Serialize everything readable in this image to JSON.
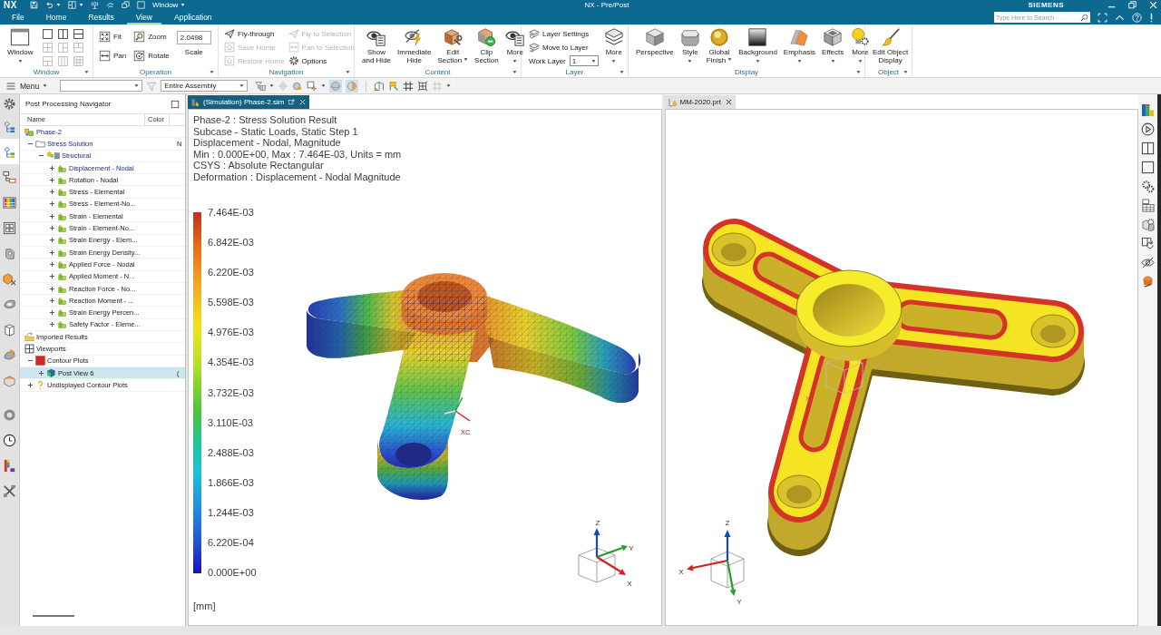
{
  "title_bar": {
    "logo": "NX",
    "window_menu": "Window",
    "title": "NX - Pre/Post",
    "brand": "SIEMENS"
  },
  "menu_tabs": [
    {
      "label": "File",
      "selected": false
    },
    {
      "label": "Home",
      "selected": false
    },
    {
      "label": "Results",
      "selected": false
    },
    {
      "label": "View",
      "selected": true
    },
    {
      "label": "Application",
      "selected": false
    }
  ],
  "search": {
    "placeholder": "Type Here to Search"
  },
  "ribbon": [
    {
      "label": "Window",
      "items": [
        {
          "kind": "large",
          "label": "Window",
          "caret": true
        },
        {
          "kind": "layout_grid",
          "cells": [
            {
              "disabled": false
            },
            {
              "disabled": false
            },
            {
              "disabled": false
            },
            {
              "disabled": true
            },
            {
              "disabled": true
            },
            {
              "disabled": true
            },
            {
              "disabled": true
            },
            {
              "disabled": true
            },
            {
              "disabled": true
            }
          ]
        }
      ]
    },
    {
      "label": "Operation",
      "items": [
        {
          "kind": "stack",
          "buttons": [
            {
              "label": "Fit",
              "disabled": false
            },
            {
              "label": "Pan",
              "disabled": false
            }
          ]
        },
        {
          "kind": "stack",
          "buttons": [
            {
              "label": "Zoom",
              "disabled": false
            },
            {
              "label": "Rotate",
              "disabled": false
            }
          ]
        },
        {
          "kind": "field",
          "label": "Scale",
          "value": "2.0498"
        }
      ]
    },
    {
      "label": "Navigation",
      "items": [
        {
          "kind": "stack",
          "buttons": [
            {
              "label": "Fly-through",
              "disabled": false
            },
            {
              "label": "Save Home",
              "disabled": true
            },
            {
              "label": "Restore Home",
              "disabled": true
            }
          ]
        },
        {
          "kind": "stack",
          "buttons": [
            {
              "label": "Fly to Selection",
              "disabled": true
            },
            {
              "label": "Pan to Selection",
              "disabled": true
            },
            {
              "label": "Options",
              "disabled": false
            }
          ]
        }
      ]
    },
    {
      "label": "Content",
      "items": [
        {
          "kind": "large",
          "label": "Show\nand Hide",
          "caret": false
        },
        {
          "kind": "large",
          "label": "Immediate\nHide",
          "caret": false
        },
        {
          "kind": "large",
          "label": "Edit\nSection",
          "caret": true
        },
        {
          "kind": "large",
          "label": "Clip\nSection",
          "caret": false
        },
        {
          "kind": "large",
          "label": "More",
          "caret": true
        }
      ]
    },
    {
      "label": "Layer",
      "items": [
        {
          "kind": "stack",
          "buttons": [
            {
              "kind": "button",
              "label": "Layer Settings",
              "disabled": false
            },
            {
              "kind": "button",
              "label": "Move to Layer",
              "disabled": false
            },
            {
              "kind": "select",
              "label": "Work Layer",
              "value": "1"
            }
          ]
        },
        {
          "kind": "large",
          "label": "More",
          "caret": true
        }
      ]
    },
    {
      "label": "Display",
      "items": [
        {
          "kind": "large",
          "label": "Perspective",
          "caret": false
        },
        {
          "kind": "large",
          "label": "Style",
          "caret": true
        },
        {
          "kind": "large",
          "label": "Global\nFinish",
          "caret": true
        },
        {
          "kind": "large",
          "label": "Background",
          "caret": true
        },
        {
          "kind": "large",
          "label": "Emphasis",
          "caret": true
        },
        {
          "kind": "large",
          "label": "Effects",
          "caret": true
        },
        {
          "kind": "large",
          "label": "More",
          "caret": true
        }
      ]
    },
    {
      "label": "Object",
      "items": [
        {
          "kind": "large",
          "label": "Edit Object\nDisplay",
          "caret": false
        }
      ]
    }
  ],
  "toolbar": {
    "menu": "Menu",
    "scope": "Entire Assembly",
    "toggles": [
      {
        "on": true
      },
      {
        "on": true
      }
    ]
  },
  "resource_bar": [
    {
      "selected": false
    },
    {
      "selected": true
    },
    {
      "selected": false
    },
    {
      "selected": false
    },
    {
      "selected": false
    },
    {
      "selected": false
    },
    {
      "selected": false
    },
    {
      "selected": false
    },
    {
      "selected": false
    },
    {
      "selected": false
    },
    {
      "selected": false
    },
    {
      "selected": false
    },
    {
      "selected": false
    },
    {
      "selected": false
    },
    {
      "selected": false
    }
  ],
  "navigator": {
    "title": "Post Processing Navigator",
    "columns": [
      "Name",
      "Color"
    ],
    "tree": [
      {
        "kind": "solution",
        "label": "Phase-2",
        "active": true,
        "selected": false,
        "expanded": true,
        "children": [
          {
            "kind": "folder",
            "label": "Stress Solution",
            "column_3": "N",
            "active": true,
            "selected": false,
            "expanded": true,
            "children": [
              {
                "kind": "structural",
                "label": "Structural",
                "active": true,
                "selected": false,
                "expanded": true,
                "children": [
                  {
                    "kind": "result",
                    "label": "Displacement - Nodal",
                    "active": true,
                    "selected": false,
                    "expanded": false
                  },
                  {
                    "kind": "result",
                    "label": "Rotation - Nodal",
                    "active": false,
                    "selected": false,
                    "expanded": false
                  },
                  {
                    "kind": "result",
                    "label": "Stress - Elemental",
                    "active": false,
                    "selected": false,
                    "expanded": false
                  },
                  {
                    "kind": "result",
                    "label": "Stress - Element-No...",
                    "active": false,
                    "selected": false,
                    "expanded": false
                  },
                  {
                    "kind": "result",
                    "label": "Strain - Elemental",
                    "active": false,
                    "selected": false,
                    "expanded": false
                  },
                  {
                    "kind": "result",
                    "label": "Strain - Element-No...",
                    "active": false,
                    "selected": false,
                    "expanded": false
                  },
                  {
                    "kind": "result",
                    "label": "Strain Energy - Elem...",
                    "active": false,
                    "selected": false,
                    "expanded": false
                  },
                  {
                    "kind": "result",
                    "label": "Strain Energy Density...",
                    "active": false,
                    "selected": false,
                    "expanded": false
                  },
                  {
                    "kind": "result",
                    "label": "Applied Force - Nodal",
                    "active": false,
                    "selected": false,
                    "expanded": false
                  },
                  {
                    "kind": "result",
                    "label": "Applied Moment - N...",
                    "active": false,
                    "selected": false,
                    "expanded": false
                  },
                  {
                    "kind": "result",
                    "label": "Reaction Force - No...",
                    "active": false,
                    "selected": false,
                    "expanded": false
                  },
                  {
                    "kind": "result",
                    "label": "Reaction Moment - ...",
                    "active": false,
                    "selected": false,
                    "expanded": false
                  },
                  {
                    "kind": "result",
                    "label": "Strain Energy Percen...",
                    "active": false,
                    "selected": false,
                    "expanded": false
                  },
                  {
                    "kind": "result",
                    "label": "Safety Factor - Eleme...",
                    "active": false,
                    "selected": false,
                    "expanded": false
                  }
                ]
              }
            ]
          }
        ]
      },
      {
        "kind": "imported",
        "label": "Imported Results",
        "active": false,
        "selected": false
      },
      {
        "kind": "viewports",
        "label": "Viewports",
        "active": false,
        "selected": false,
        "expanded": true,
        "children": [
          {
            "kind": "contour",
            "label": "Contour Plots",
            "active": false,
            "selected": false,
            "expanded": true,
            "children": [
              {
                "kind": "post_view",
                "label": "Post View 6",
                "column_3": "(",
                "active": false,
                "selected": true,
                "expanded": false
              }
            ]
          },
          {
            "kind": "undisplayed",
            "label": "Undisplayed Contour Plots",
            "active": false,
            "selected": false,
            "expanded": false
          }
        ]
      }
    ]
  },
  "viewports": [
    {
      "kind": "result",
      "tab": {
        "label": "(Simulation) Phase-2.sim",
        "selected": true
      },
      "info": [
        "Phase-2 : Stress Solution Result",
        "Subcase - Static Loads, Static Step 1",
        "Displacement - Nodal, Magnitude",
        "Min : 0.000E+00, Max : 7.464E-03, Units = mm",
        "CSYS : Absolute Rectangular",
        "Deformation : Displacement - Nodal Magnitude"
      ],
      "legend": {
        "labels": [
          "7.464E-03",
          "6.842E-03",
          "6.220E-03",
          "5.598E-03",
          "4.976E-03",
          "4.354E-03",
          "3.732E-03",
          "3.110E-03",
          "2.488E-03",
          "1.866E-03",
          "1.244E-03",
          "6.220E-04",
          "0.000E+00"
        ],
        "unit": "[mm]"
      },
      "wcs_label": "XC",
      "axis_labels": [
        "Z",
        "Y",
        "X"
      ]
    },
    {
      "kind": "part",
      "tab": {
        "label": "MM-2020.prt",
        "selected": false
      },
      "wcs_label": "X",
      "axis_labels": [
        "Z",
        "X",
        "Y"
      ]
    }
  ]
}
